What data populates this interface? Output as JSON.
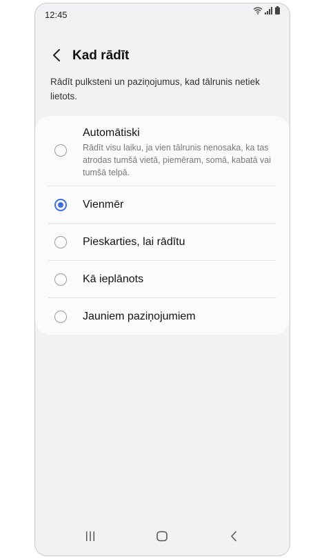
{
  "status_bar": {
    "time": "12:45",
    "icons": [
      "wifi-icon",
      "signal-icon",
      "battery-icon"
    ]
  },
  "header": {
    "back_icon": "chevron-left-icon",
    "title": "Kad rādīt"
  },
  "description": "Rādīt pulksteni un paziņojumus, kad tālrunis netiek lietots.",
  "options": [
    {
      "label": "Automātiski",
      "sublabel": "Rādīt visu laiku, ja vien tālrunis nenosaka, ka tas atrodas tumšā vietā, piemēram, somā, kabatā vai tumšā telpā.",
      "selected": false
    },
    {
      "label": "Vienmēr",
      "selected": true
    },
    {
      "label": "Pieskarties, lai rādītu",
      "selected": false
    },
    {
      "label": "Kā ieplānots",
      "selected": false
    },
    {
      "label": "Jauniem paziņojumiem",
      "selected": false
    }
  ],
  "colors": {
    "accent": "#3e6fd8",
    "background": "#f2f2f4",
    "card": "#fbfbfd"
  },
  "nav_bar": {
    "icons": [
      "recents-icon",
      "home-icon",
      "back-icon"
    ]
  }
}
